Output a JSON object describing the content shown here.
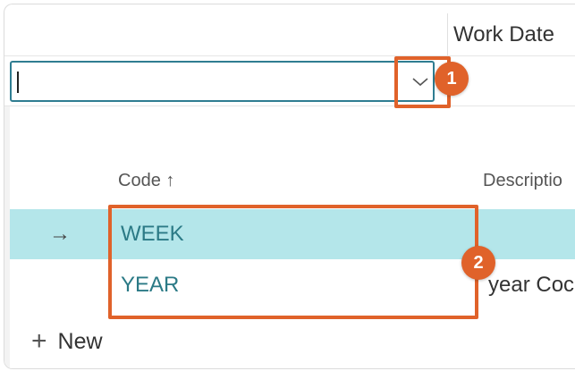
{
  "header": {
    "work_date_label": "Work Date"
  },
  "lookup": {
    "input_value": "",
    "columns": {
      "code": "Code ↑",
      "description": "Descriptio"
    },
    "rows": [
      {
        "marker": "→",
        "code": "WEEK",
        "description": "",
        "selected": true
      },
      {
        "marker": "",
        "code": "YEAR",
        "description": "year Coc",
        "selected": false
      }
    ],
    "new_label": "New"
  },
  "callouts": {
    "step1": "1",
    "step2": "2"
  },
  "colors": {
    "accent": "#e0622a",
    "selected_row": "#b4e6ea",
    "code_link": "#2b7a86"
  },
  "icons": {
    "dropdown": "chevron-down-icon",
    "new": "plus-icon",
    "row_marker": "arrow-right-icon"
  }
}
